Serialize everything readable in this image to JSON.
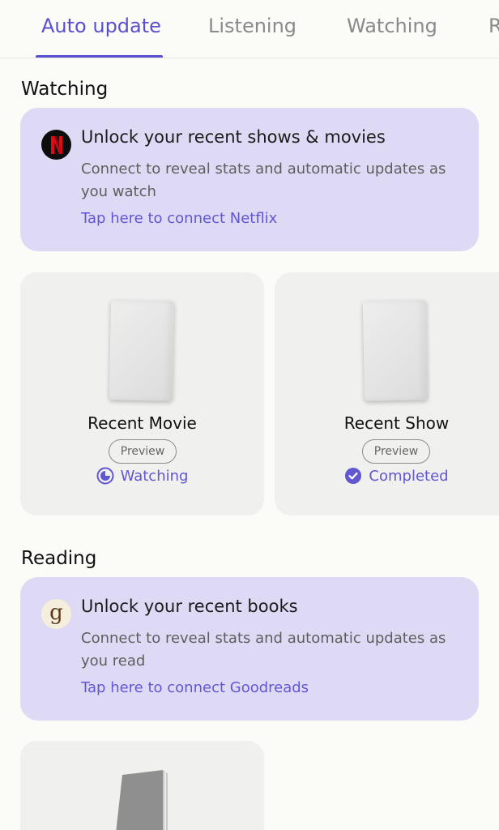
{
  "tabs": [
    {
      "label": "Auto update",
      "active": true
    },
    {
      "label": "Listening",
      "active": false
    },
    {
      "label": "Watching",
      "active": false
    },
    {
      "label": "R",
      "active": false
    }
  ],
  "watching": {
    "section_title": "Watching",
    "connect_card": {
      "icon": "netflix-icon",
      "icon_letter": "N",
      "heading": "Unlock your recent shows & movies",
      "description": "Connect to reveal stats and automatic updates as you watch",
      "link": "Tap here to connect Netflix"
    },
    "items": [
      {
        "title": "Recent Movie",
        "badge": "Preview",
        "status": "Watching",
        "status_icon": "in-progress-icon"
      },
      {
        "title": "Recent Show",
        "badge": "Preview",
        "status": "Completed",
        "status_icon": "check-circle-icon"
      }
    ]
  },
  "reading": {
    "section_title": "Reading",
    "connect_card": {
      "icon": "goodreads-icon",
      "icon_letter": "g",
      "heading": "Unlock your recent books",
      "description": "Connect to reveal stats and automatic updates as you read",
      "link": "Tap here to connect Goodreads"
    }
  },
  "colors": {
    "accent": "#5a4fcf",
    "card_background": "#dedaf6",
    "netflix_red": "#e50914"
  }
}
